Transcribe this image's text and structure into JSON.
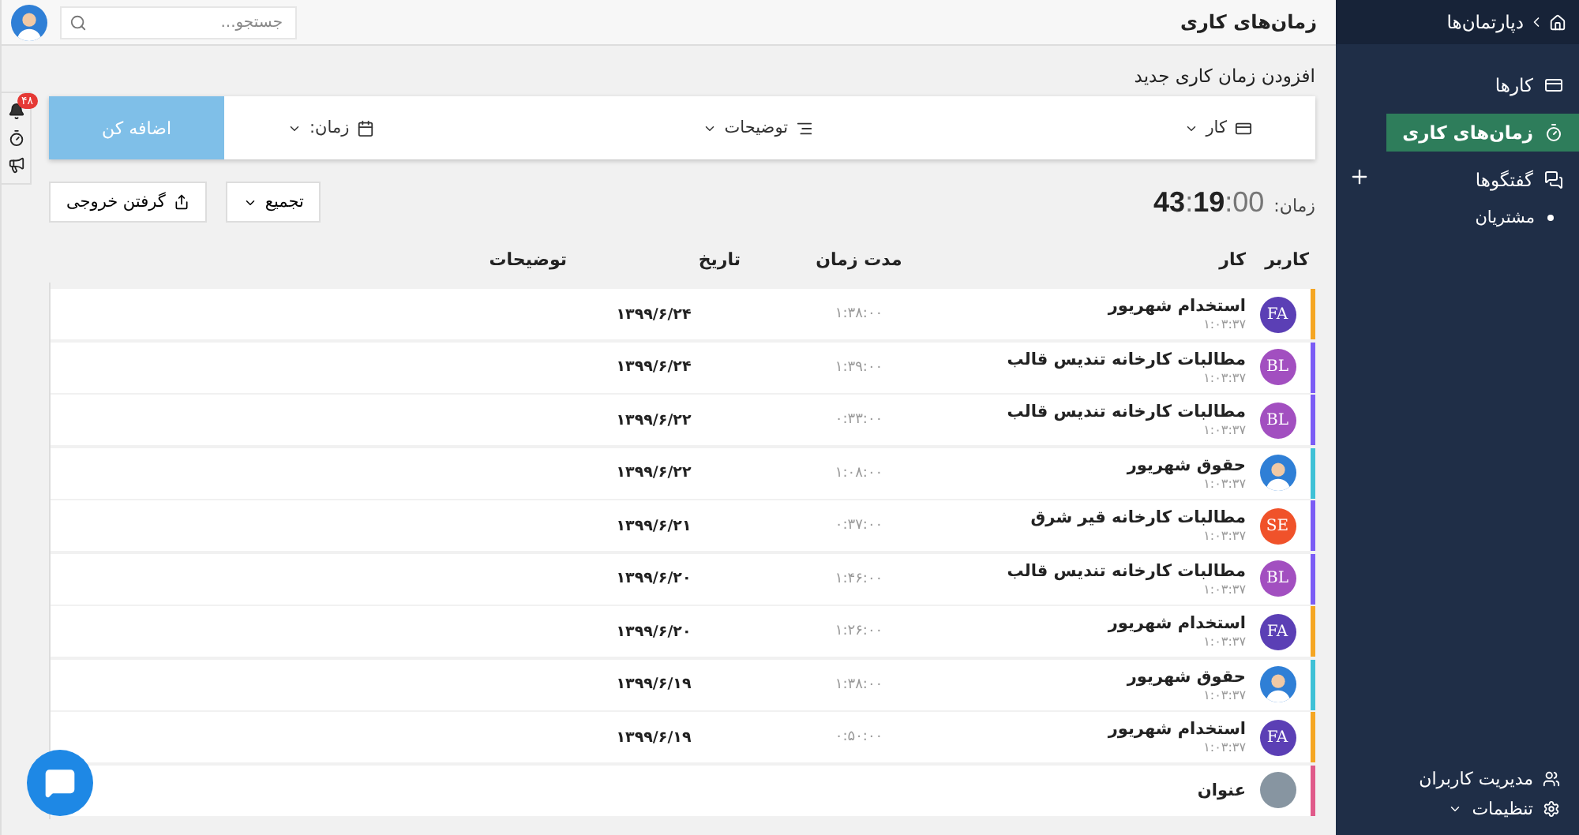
{
  "sidebar": {
    "header": {
      "label": "دپارتمان‌ها"
    },
    "items": [
      {
        "label": "کارها",
        "selected": false
      },
      {
        "label": "زمان‌های کاری",
        "selected": true
      },
      {
        "label": "گفتگوها",
        "selected": false,
        "children": [
          {
            "label": "مشتریان",
            "selected": false
          }
        ]
      }
    ],
    "footer": [
      {
        "label": "مدیریت کاربران",
        "dropdown": false
      },
      {
        "label": "تنظیمات",
        "dropdown": true
      }
    ]
  },
  "topbar": {
    "title": "زمان‌های کاری",
    "search": {
      "placeholder": "جستجو..."
    }
  },
  "side_tools": {
    "badge": "۴۸"
  },
  "new_entry": {
    "heading": "افزودن زمان کاری جدید",
    "fields": [
      {
        "label": "کار"
      },
      {
        "label": "توضیحات"
      },
      {
        "label": "زمان:"
      }
    ],
    "submit": {
      "label": "اضافه کن",
      "disabled": true
    }
  },
  "total": {
    "label": "زمان:",
    "value": "**43**:**19**:00"
  },
  "actions": [
    {
      "label": "تجمیع",
      "kind": "dropdown"
    },
    {
      "label": "گرفتن خروجی",
      "kind": "export"
    }
  ],
  "table": {
    "columns": [
      "کاربر",
      "کار",
      "مدت زمان",
      "تاریخ",
      "توضیحات"
    ],
    "rows": [
      {
        "avatar": {
          "kind": "initials",
          "initials": "FA",
          "color": "#5b3fb5"
        },
        "color": "#f5a623",
        "task": "استخدام شهریور",
        "elapsed": "۱:۰۳:۳۷",
        "duration": "۱:۳۸:۰۰",
        "date": "۱۳۹۹/۶/۲۴"
      },
      {
        "avatar": {
          "kind": "initials",
          "initials": "BL",
          "color": "#a24fc0"
        },
        "color": "#7b5cf5",
        "task": "مطالبات کارخانه تندیس قالب",
        "elapsed": "۱:۰۳:۳۷",
        "duration": "۱:۳۹:۰۰",
        "date": "۱۳۹۹/۶/۲۴"
      },
      {
        "avatar": {
          "kind": "initials",
          "initials": "BL",
          "color": "#a24fc0"
        },
        "color": "#7b5cf5",
        "task": "مطالبات کارخانه تندیس قالب",
        "elapsed": "۱:۰۳:۳۷",
        "duration": "۰:۳۳:۰۰",
        "date": "۱۳۹۹/۶/۲۲"
      },
      {
        "avatar": {
          "kind": "photo"
        },
        "color": "#3fc1d6",
        "task": "حقوق شهریور",
        "elapsed": "۱:۰۳:۳۷",
        "duration": "۱:۰۸:۰۰",
        "date": "۱۳۹۹/۶/۲۲"
      },
      {
        "avatar": {
          "kind": "initials",
          "initials": "SE",
          "color": "#f0522a"
        },
        "color": "#7b5cf5",
        "task": "مطالبات کارخانه قیر شرق",
        "elapsed": "۱:۰۳:۳۷",
        "duration": "۰:۳۷:۰۰",
        "date": "۱۳۹۹/۶/۲۱"
      },
      {
        "avatar": {
          "kind": "initials",
          "initials": "BL",
          "color": "#a24fc0"
        },
        "color": "#7b5cf5",
        "task": "مطالبات کارخانه تندیس قالب",
        "elapsed": "۱:۰۳:۳۷",
        "duration": "۱:۴۶:۰۰",
        "date": "۱۳۹۹/۶/۲۰"
      },
      {
        "avatar": {
          "kind": "initials",
          "initials": "FA",
          "color": "#5b3fb5"
        },
        "color": "#f5a623",
        "task": "استخدام شهریور",
        "elapsed": "۱:۰۳:۳۷",
        "duration": "۱:۲۶:۰۰",
        "date": "۱۳۹۹/۶/۲۰"
      },
      {
        "avatar": {
          "kind": "photo"
        },
        "color": "#3fc1d6",
        "task": "حقوق شهریور",
        "elapsed": "۱:۰۳:۳۷",
        "duration": "۱:۳۸:۰۰",
        "date": "۱۳۹۹/۶/۱۹"
      },
      {
        "avatar": {
          "kind": "initials",
          "initials": "FA",
          "color": "#5b3fb5"
        },
        "color": "#f5a623",
        "task": "استخدام شهریور",
        "elapsed": "۱:۰۳:۳۷",
        "duration": "۰:۵۰:۰۰",
        "date": "۱۳۹۹/۶/۱۹"
      },
      {
        "avatar": {
          "kind": "blank",
          "color": "#8795a1"
        },
        "color": "#e05a8a",
        "task": "عنوان"
      }
    ]
  }
}
